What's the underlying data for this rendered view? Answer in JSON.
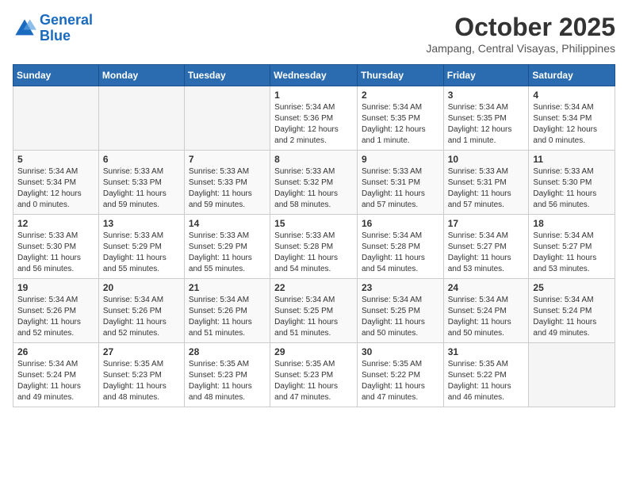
{
  "header": {
    "logo_line1": "General",
    "logo_line2": "Blue",
    "month": "October 2025",
    "location": "Jampang, Central Visayas, Philippines"
  },
  "weekdays": [
    "Sunday",
    "Monday",
    "Tuesday",
    "Wednesday",
    "Thursday",
    "Friday",
    "Saturday"
  ],
  "weeks": [
    [
      {
        "day": "",
        "info": ""
      },
      {
        "day": "",
        "info": ""
      },
      {
        "day": "",
        "info": ""
      },
      {
        "day": "1",
        "info": "Sunrise: 5:34 AM\nSunset: 5:36 PM\nDaylight: 12 hours\nand 2 minutes."
      },
      {
        "day": "2",
        "info": "Sunrise: 5:34 AM\nSunset: 5:35 PM\nDaylight: 12 hours\nand 1 minute."
      },
      {
        "day": "3",
        "info": "Sunrise: 5:34 AM\nSunset: 5:35 PM\nDaylight: 12 hours\nand 1 minute."
      },
      {
        "day": "4",
        "info": "Sunrise: 5:34 AM\nSunset: 5:34 PM\nDaylight: 12 hours\nand 0 minutes."
      }
    ],
    [
      {
        "day": "5",
        "info": "Sunrise: 5:34 AM\nSunset: 5:34 PM\nDaylight: 12 hours\nand 0 minutes."
      },
      {
        "day": "6",
        "info": "Sunrise: 5:33 AM\nSunset: 5:33 PM\nDaylight: 11 hours\nand 59 minutes."
      },
      {
        "day": "7",
        "info": "Sunrise: 5:33 AM\nSunset: 5:33 PM\nDaylight: 11 hours\nand 59 minutes."
      },
      {
        "day": "8",
        "info": "Sunrise: 5:33 AM\nSunset: 5:32 PM\nDaylight: 11 hours\nand 58 minutes."
      },
      {
        "day": "9",
        "info": "Sunrise: 5:33 AM\nSunset: 5:31 PM\nDaylight: 11 hours\nand 57 minutes."
      },
      {
        "day": "10",
        "info": "Sunrise: 5:33 AM\nSunset: 5:31 PM\nDaylight: 11 hours\nand 57 minutes."
      },
      {
        "day": "11",
        "info": "Sunrise: 5:33 AM\nSunset: 5:30 PM\nDaylight: 11 hours\nand 56 minutes."
      }
    ],
    [
      {
        "day": "12",
        "info": "Sunrise: 5:33 AM\nSunset: 5:30 PM\nDaylight: 11 hours\nand 56 minutes."
      },
      {
        "day": "13",
        "info": "Sunrise: 5:33 AM\nSunset: 5:29 PM\nDaylight: 11 hours\nand 55 minutes."
      },
      {
        "day": "14",
        "info": "Sunrise: 5:33 AM\nSunset: 5:29 PM\nDaylight: 11 hours\nand 55 minutes."
      },
      {
        "day": "15",
        "info": "Sunrise: 5:33 AM\nSunset: 5:28 PM\nDaylight: 11 hours\nand 54 minutes."
      },
      {
        "day": "16",
        "info": "Sunrise: 5:34 AM\nSunset: 5:28 PM\nDaylight: 11 hours\nand 54 minutes."
      },
      {
        "day": "17",
        "info": "Sunrise: 5:34 AM\nSunset: 5:27 PM\nDaylight: 11 hours\nand 53 minutes."
      },
      {
        "day": "18",
        "info": "Sunrise: 5:34 AM\nSunset: 5:27 PM\nDaylight: 11 hours\nand 53 minutes."
      }
    ],
    [
      {
        "day": "19",
        "info": "Sunrise: 5:34 AM\nSunset: 5:26 PM\nDaylight: 11 hours\nand 52 minutes."
      },
      {
        "day": "20",
        "info": "Sunrise: 5:34 AM\nSunset: 5:26 PM\nDaylight: 11 hours\nand 52 minutes."
      },
      {
        "day": "21",
        "info": "Sunrise: 5:34 AM\nSunset: 5:26 PM\nDaylight: 11 hours\nand 51 minutes."
      },
      {
        "day": "22",
        "info": "Sunrise: 5:34 AM\nSunset: 5:25 PM\nDaylight: 11 hours\nand 51 minutes."
      },
      {
        "day": "23",
        "info": "Sunrise: 5:34 AM\nSunset: 5:25 PM\nDaylight: 11 hours\nand 50 minutes."
      },
      {
        "day": "24",
        "info": "Sunrise: 5:34 AM\nSunset: 5:24 PM\nDaylight: 11 hours\nand 50 minutes."
      },
      {
        "day": "25",
        "info": "Sunrise: 5:34 AM\nSunset: 5:24 PM\nDaylight: 11 hours\nand 49 minutes."
      }
    ],
    [
      {
        "day": "26",
        "info": "Sunrise: 5:34 AM\nSunset: 5:24 PM\nDaylight: 11 hours\nand 49 minutes."
      },
      {
        "day": "27",
        "info": "Sunrise: 5:35 AM\nSunset: 5:23 PM\nDaylight: 11 hours\nand 48 minutes."
      },
      {
        "day": "28",
        "info": "Sunrise: 5:35 AM\nSunset: 5:23 PM\nDaylight: 11 hours\nand 48 minutes."
      },
      {
        "day": "29",
        "info": "Sunrise: 5:35 AM\nSunset: 5:23 PM\nDaylight: 11 hours\nand 47 minutes."
      },
      {
        "day": "30",
        "info": "Sunrise: 5:35 AM\nSunset: 5:22 PM\nDaylight: 11 hours\nand 47 minutes."
      },
      {
        "day": "31",
        "info": "Sunrise: 5:35 AM\nSunset: 5:22 PM\nDaylight: 11 hours\nand 46 minutes."
      },
      {
        "day": "",
        "info": ""
      }
    ]
  ]
}
